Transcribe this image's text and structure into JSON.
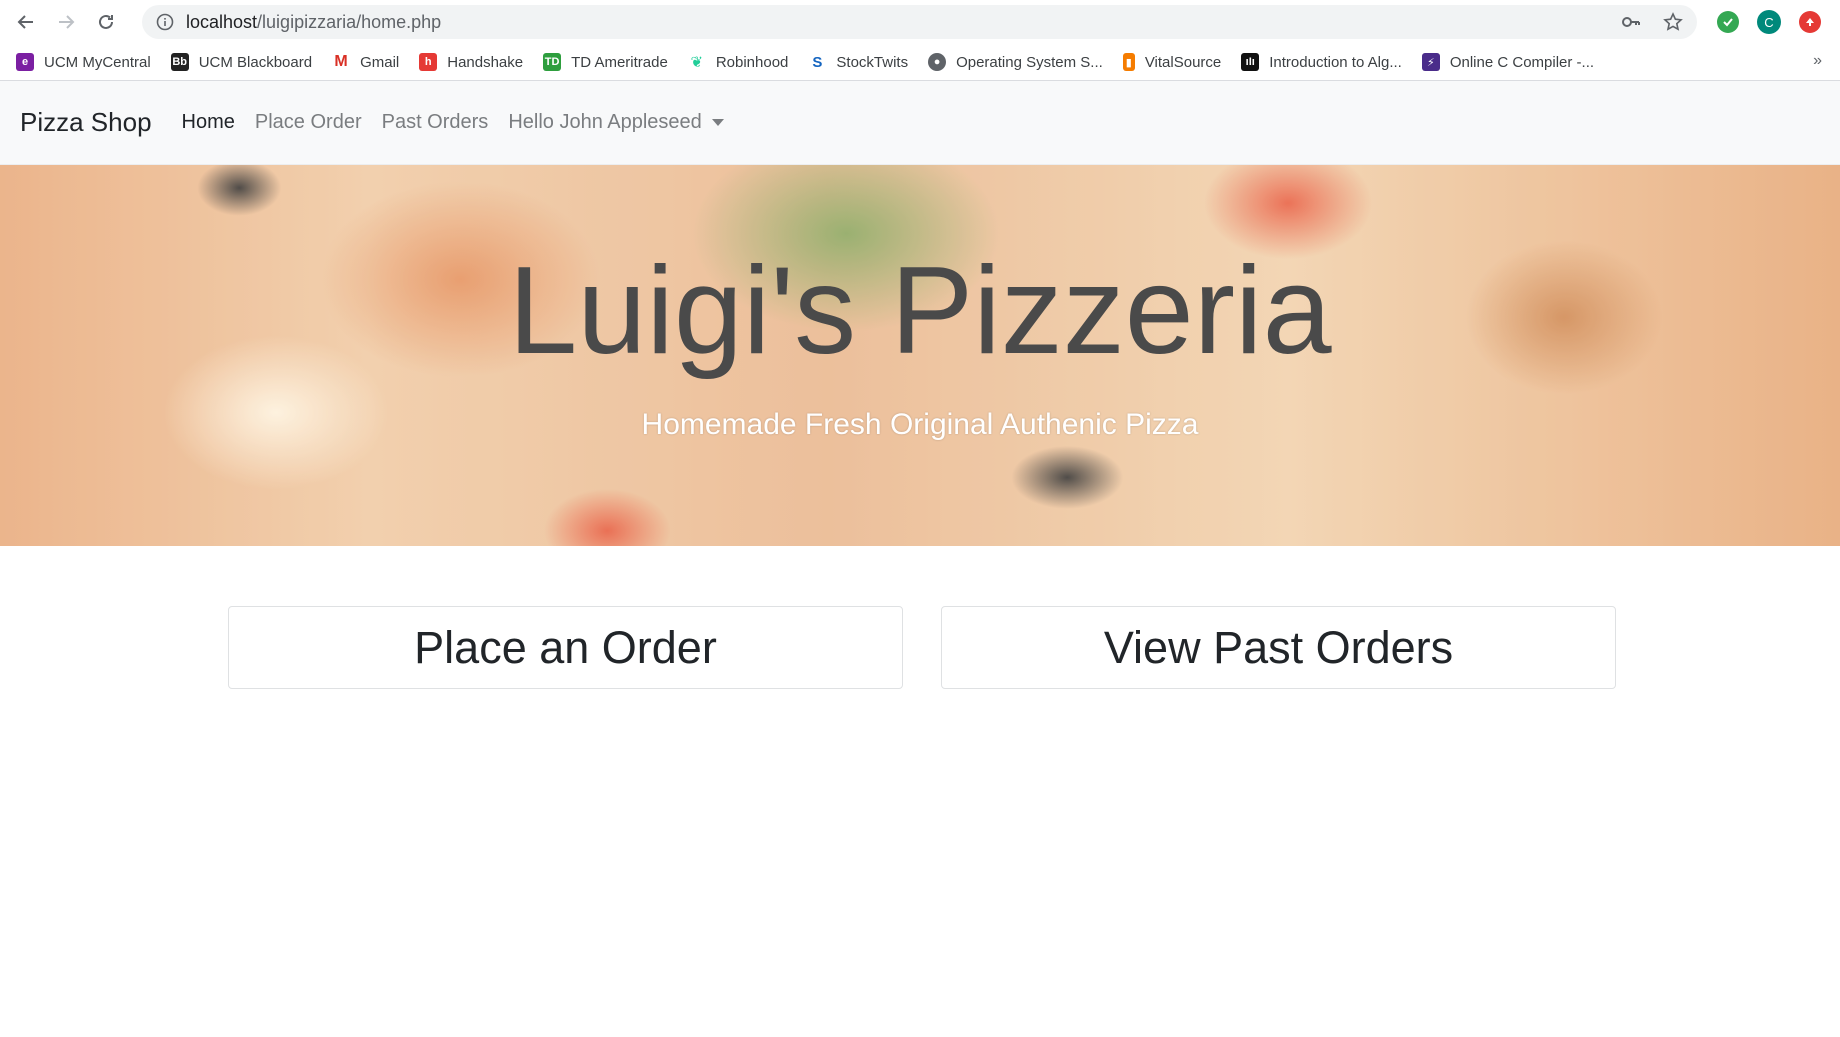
{
  "browser": {
    "url_host": "localhost",
    "url_path": "/luigipizzaria/home.php",
    "avatar_letter": "C",
    "bookmarks": [
      {
        "label": "UCM MyCentral",
        "icon": "ucm-icon",
        "color": "#7b1fa2"
      },
      {
        "label": "UCM Blackboard",
        "icon": "blackboard-icon",
        "color": "#222222"
      },
      {
        "label": "Gmail",
        "icon": "gmail-icon",
        "color": "#d93025"
      },
      {
        "label": "Handshake",
        "icon": "handshake-icon",
        "color": "#e53935"
      },
      {
        "label": "TD Ameritrade",
        "icon": "td-icon",
        "color": "#2e9e3e"
      },
      {
        "label": "Robinhood",
        "icon": "robinhood-icon",
        "color": "#21ce99"
      },
      {
        "label": "StockTwits",
        "icon": "stocktwits-icon",
        "color": "#1565c0"
      },
      {
        "label": "Operating System S...",
        "icon": "globe-icon",
        "color": "#5f6368"
      },
      {
        "label": "VitalSource",
        "icon": "vitalsource-icon",
        "color": "#f57c00"
      },
      {
        "label": "Introduction to Alg...",
        "icon": "mit-icon",
        "color": "#111111"
      },
      {
        "label": "Online C Compiler -...",
        "icon": "compiler-icon",
        "color": "#4a2c8a"
      }
    ],
    "more_label": "»"
  },
  "navbar": {
    "brand": "Pizza Shop",
    "links": [
      {
        "label": "Home",
        "active": true
      },
      {
        "label": "Place Order",
        "active": false
      },
      {
        "label": "Past Orders",
        "active": false
      }
    ],
    "user_menu": "Hello John Appleseed"
  },
  "hero": {
    "title": "Luigi's Pizzeria",
    "subtitle": "Homemade Fresh Original Authenic Pizza"
  },
  "actions": {
    "place_order": "Place an Order",
    "view_past_orders": "View Past Orders"
  }
}
